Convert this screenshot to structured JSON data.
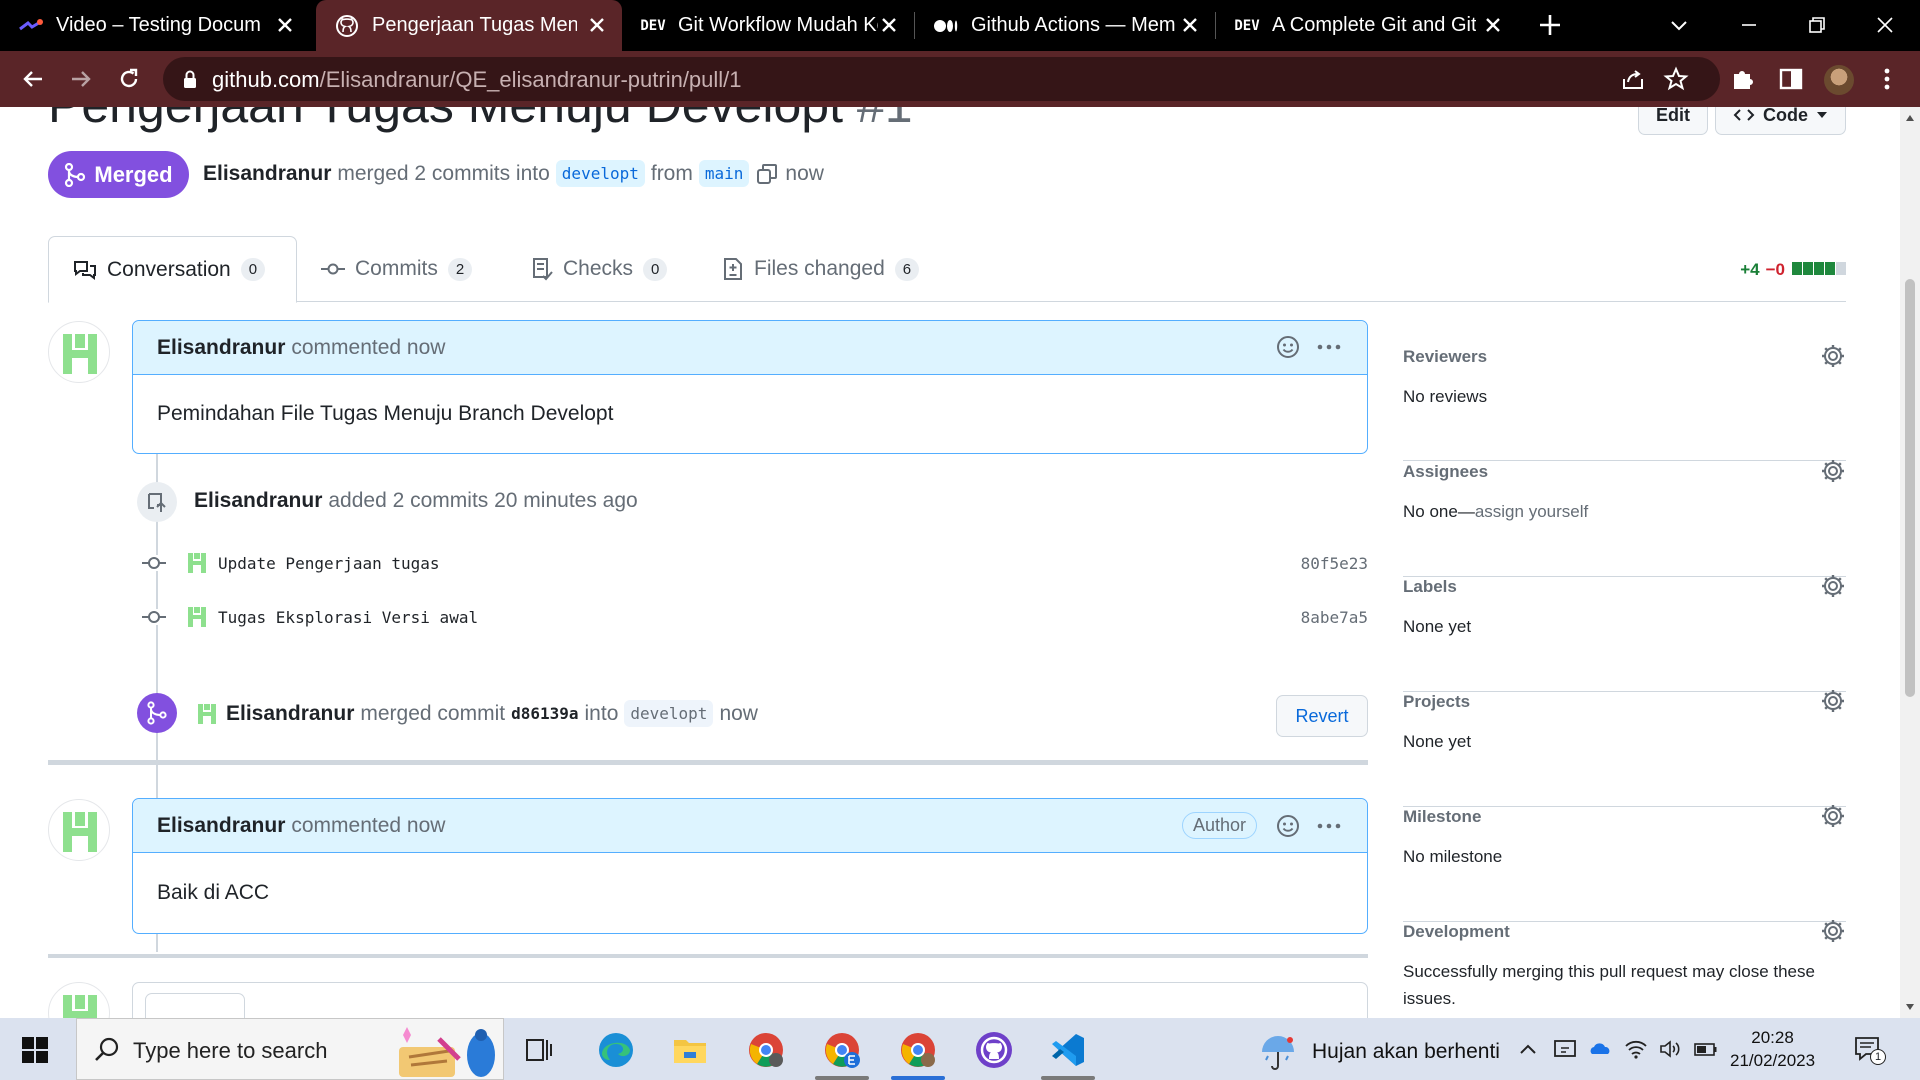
{
  "browser": {
    "tabs": [
      {
        "title": "Video – Testing Documen",
        "icon": "video-app-icon",
        "active": false
      },
      {
        "title": "Pengerjaan Tugas Menuju",
        "icon": "github-icon",
        "active": true
      },
      {
        "title": "Git Workflow Mudah Kok!",
        "icon": "dev-icon",
        "active": false
      },
      {
        "title": "Github Actions — Membu",
        "icon": "medium-icon",
        "active": false
      },
      {
        "title": "A Complete Git and GitHu",
        "icon": "dev-icon",
        "active": false
      }
    ],
    "dev_badge": "DEV",
    "url_host": "github.com",
    "url_path": "/Elisandranur/QE_elisandranur-putrin/pull/1"
  },
  "pr": {
    "title": "Pengerjaan Tugas Menuju Developt",
    "number": "#1",
    "edit_label": "Edit",
    "code_label": "Code",
    "state": "Merged",
    "author": "Elisandranur",
    "merged_text": "merged 2 commits into",
    "base_branch": "developt",
    "from_text": "from",
    "head_branch": "main",
    "time": "now",
    "tabs": [
      {
        "label": "Conversation",
        "count": "0",
        "icon": "conversation-icon"
      },
      {
        "label": "Commits",
        "count": "2",
        "icon": "commit-icon"
      },
      {
        "label": "Checks",
        "count": "0",
        "icon": "checks-icon"
      },
      {
        "label": "Files changed",
        "count": "6",
        "icon": "file-diff-icon"
      }
    ],
    "diffstat": {
      "additions": "+4",
      "deletions": "−0"
    }
  },
  "timeline": {
    "comment1": {
      "author": "Elisandranur",
      "action": "commented now",
      "body": "Pemindahan File Tugas Menuju Branch Developt"
    },
    "commits_event": {
      "author": "Elisandranur",
      "text": "added 2 commits 20 minutes ago"
    },
    "commits": [
      {
        "message": "Update Pengerjaan tugas",
        "sha": "80f5e23"
      },
      {
        "message": "Tugas Eksplorasi Versi awal",
        "sha": "8abe7a5"
      }
    ],
    "merge_event": {
      "author": "Elisandranur",
      "text": "merged commit",
      "sha": "d86139a",
      "into": "into",
      "branch": "developt",
      "time": "now",
      "revert_label": "Revert"
    },
    "comment2": {
      "author": "Elisandranur",
      "action": "commented now",
      "badge": "Author",
      "body": "Baik di ACC"
    }
  },
  "sidebar": [
    {
      "title": "Reviewers",
      "value": "No reviews"
    },
    {
      "title": "Assignees",
      "value": "No one—",
      "link": "assign yourself"
    },
    {
      "title": "Labels",
      "value": "None yet"
    },
    {
      "title": "Projects",
      "value": "None yet"
    },
    {
      "title": "Milestone",
      "value": "No milestone"
    },
    {
      "title": "Development",
      "value": "Successfully merging this pull request may close these issues."
    }
  ],
  "taskbar": {
    "search_placeholder": "Type here to search",
    "weather": "Hujan akan berhenti",
    "time": "20:28",
    "date": "21/02/2023",
    "notification_count": "1"
  },
  "colors": {
    "merged": "#8250df",
    "accent_blue": "#0969da",
    "additions": "#1a7f37",
    "deletions": "#cf222e",
    "browser_frame": "#5a2528"
  }
}
